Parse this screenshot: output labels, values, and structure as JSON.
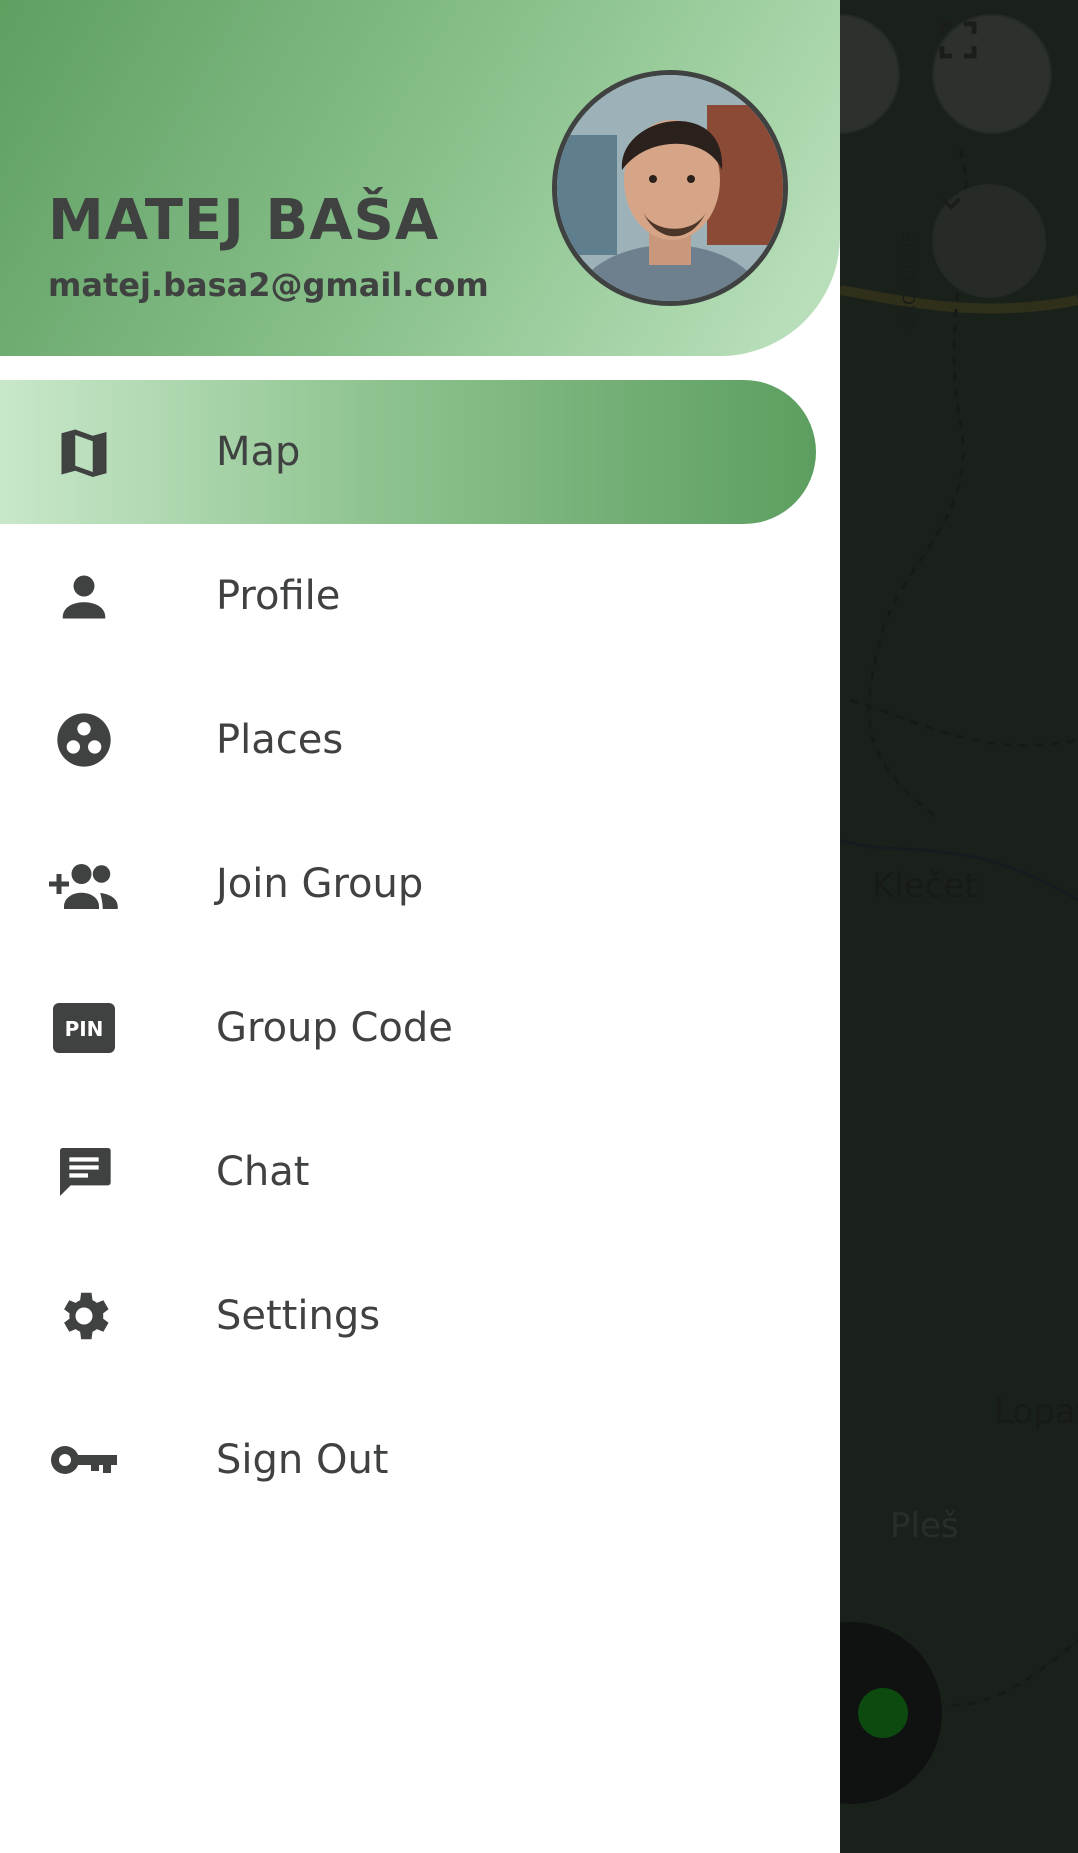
{
  "user": {
    "name": "MATEJ BAŠA",
    "email": "matej.basa2@gmail.com",
    "avatar": "profile-photo"
  },
  "menu": {
    "items": [
      {
        "label": "Map",
        "icon": "map-icon",
        "active": true
      },
      {
        "label": "Profile",
        "icon": "person-icon",
        "active": false
      },
      {
        "label": "Places",
        "icon": "places-icon",
        "active": false
      },
      {
        "label": "Join Group",
        "icon": "group-add-icon",
        "active": false
      },
      {
        "label": "Group Code",
        "icon": "pin-icon",
        "active": false
      },
      {
        "label": "Chat",
        "icon": "chat-icon",
        "active": false
      },
      {
        "label": "Settings",
        "icon": "gear-icon",
        "active": false
      },
      {
        "label": "Sign Out",
        "icon": "key-icon",
        "active": false
      }
    ],
    "pin_text": "PIN"
  },
  "map": {
    "labels": {
      "klecet": "Klečet",
      "lopat": "Lopat",
      "ples": "Pleš",
      "road": "GROSUPLJE"
    }
  },
  "colors": {
    "header_gradient_start": "#5e9f62",
    "header_gradient_end": "#bfe3c0",
    "text": "#3f4240",
    "active_item_start": "#c9e8ca",
    "active_item_end": "#5c9e60"
  }
}
